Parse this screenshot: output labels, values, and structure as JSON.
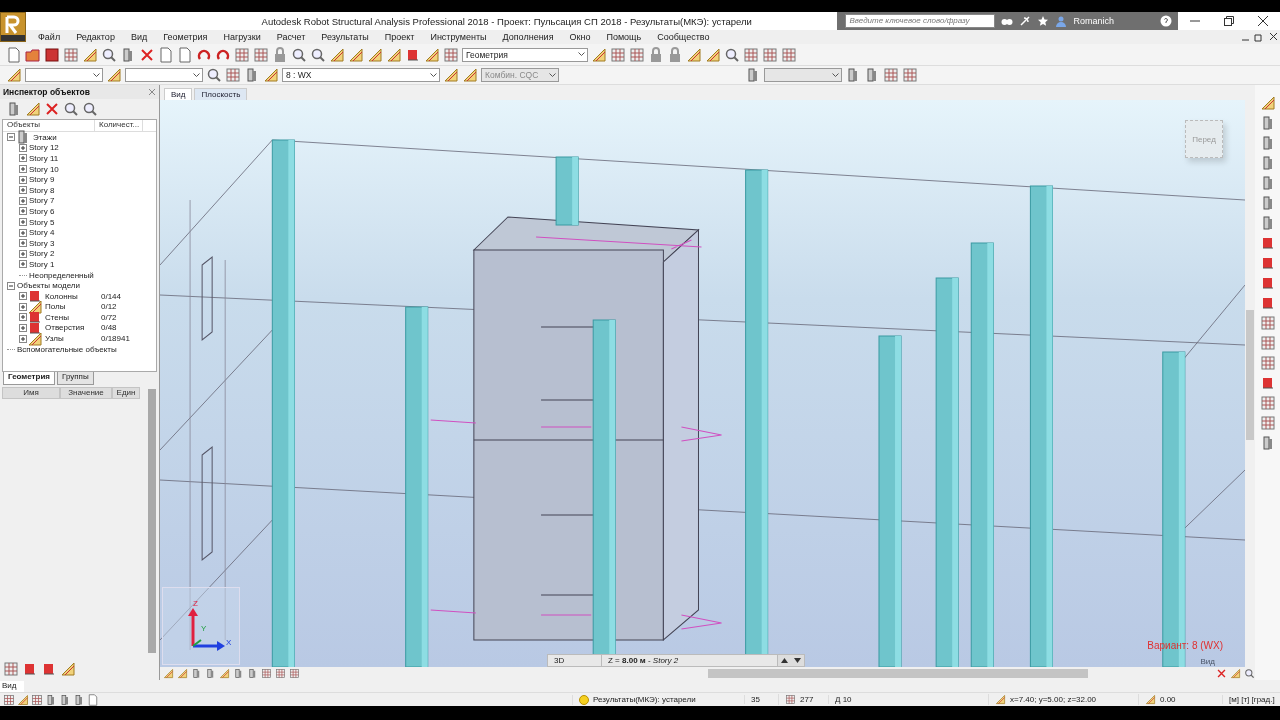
{
  "title_bar": {
    "title": "Autodesk Robot Structural Analysis Professional 2018 - Проект: Пульсация СП 2018 - Результаты(МКЭ): устарели",
    "search_placeholder": "Введите ключевое слово/фразу",
    "user": "Romanich"
  },
  "menu": [
    "Файл",
    "Редактор",
    "Вид",
    "Геометрия",
    "Нагрузки",
    "Расчет",
    "Результаты",
    "Проект",
    "Инструменты",
    "Дополнения",
    "Окно",
    "Помощь",
    "Сообщество"
  ],
  "toolbar": {
    "view_select": {
      "value": "Геометрия"
    },
    "case_select": {
      "value": "8 : WX"
    },
    "combination_select": {
      "value": "Комбин. CQC",
      "disabled": true
    }
  },
  "inspector": {
    "title": "Инспектор объектов",
    "columns": [
      "Объекты",
      "Количест..."
    ],
    "tree": [
      {
        "label": "Этажи",
        "kind": "toggle",
        "expanded": true,
        "children": [
          {
            "label": "Story 12",
            "kind": "toggle",
            "expanded": false
          },
          {
            "label": "Story 11",
            "kind": "toggle",
            "expanded": false
          },
          {
            "label": "Story 10",
            "kind": "toggle",
            "expanded": false
          },
          {
            "label": "Story 9",
            "kind": "toggle",
            "expanded": false
          },
          {
            "label": "Story 8",
            "kind": "toggle",
            "expanded": false
          },
          {
            "label": "Story 7",
            "kind": "toggle",
            "expanded": false
          },
          {
            "label": "Story 6",
            "kind": "toggle",
            "expanded": false
          },
          {
            "label": "Story 5",
            "kind": "toggle",
            "expanded": false
          },
          {
            "label": "Story 4",
            "kind": "toggle",
            "expanded": false
          },
          {
            "label": "Story 3",
            "kind": "toggle",
            "expanded": false
          },
          {
            "label": "Story 2",
            "kind": "toggle",
            "expanded": false
          },
          {
            "label": "Story 1",
            "kind": "toggle",
            "expanded": false
          },
          {
            "label": "Неопределенный",
            "kind": "plain"
          }
        ]
      },
      {
        "label": "Объекты модели",
        "kind": "toggle",
        "expanded": true,
        "children": [
          {
            "label": "Колонны",
            "kind": "toggle",
            "expanded": false,
            "count": "0/144"
          },
          {
            "label": "Полы",
            "kind": "toggle",
            "expanded": false,
            "count": "0/12"
          },
          {
            "label": "Стены",
            "kind": "toggle",
            "expanded": false,
            "count": "0/72"
          },
          {
            "label": "Отверстия",
            "kind": "toggle",
            "expanded": false,
            "count": "0/48"
          },
          {
            "label": "Узлы",
            "kind": "toggle",
            "expanded": false,
            "count": "0/18941"
          }
        ]
      },
      {
        "label": "Вспомогательные объекты",
        "kind": "plain"
      }
    ],
    "tabs": [
      {
        "label": "Геометрия",
        "selected": true
      },
      {
        "label": "Группы",
        "selected": false
      }
    ]
  },
  "properties": {
    "columns": [
      "Имя",
      "Значение",
      "Един"
    ]
  },
  "view_field": {
    "value": "Вид"
  },
  "viewport": {
    "tabs": [
      {
        "label": "Вид",
        "selected": true
      },
      {
        "label": "Плоскость",
        "selected": false
      }
    ],
    "view_cube": "Перед",
    "axes": [
      "Z",
      "Y",
      "X"
    ],
    "variant": "Вариант: 8 (WX)",
    "corner_label": "Вид",
    "layer_bar": {
      "mode": "3D",
      "level": "Z = **8.00 м** - *Story 2*"
    }
  },
  "status_bar": {
    "message": "Результаты(МКЭ): устарели",
    "items": [
      "35",
      "277",
      "Д 10",
      "x=7.40; y=5.00; z=32.00",
      "0.00",
      "[м] [т] [град.]"
    ]
  }
}
